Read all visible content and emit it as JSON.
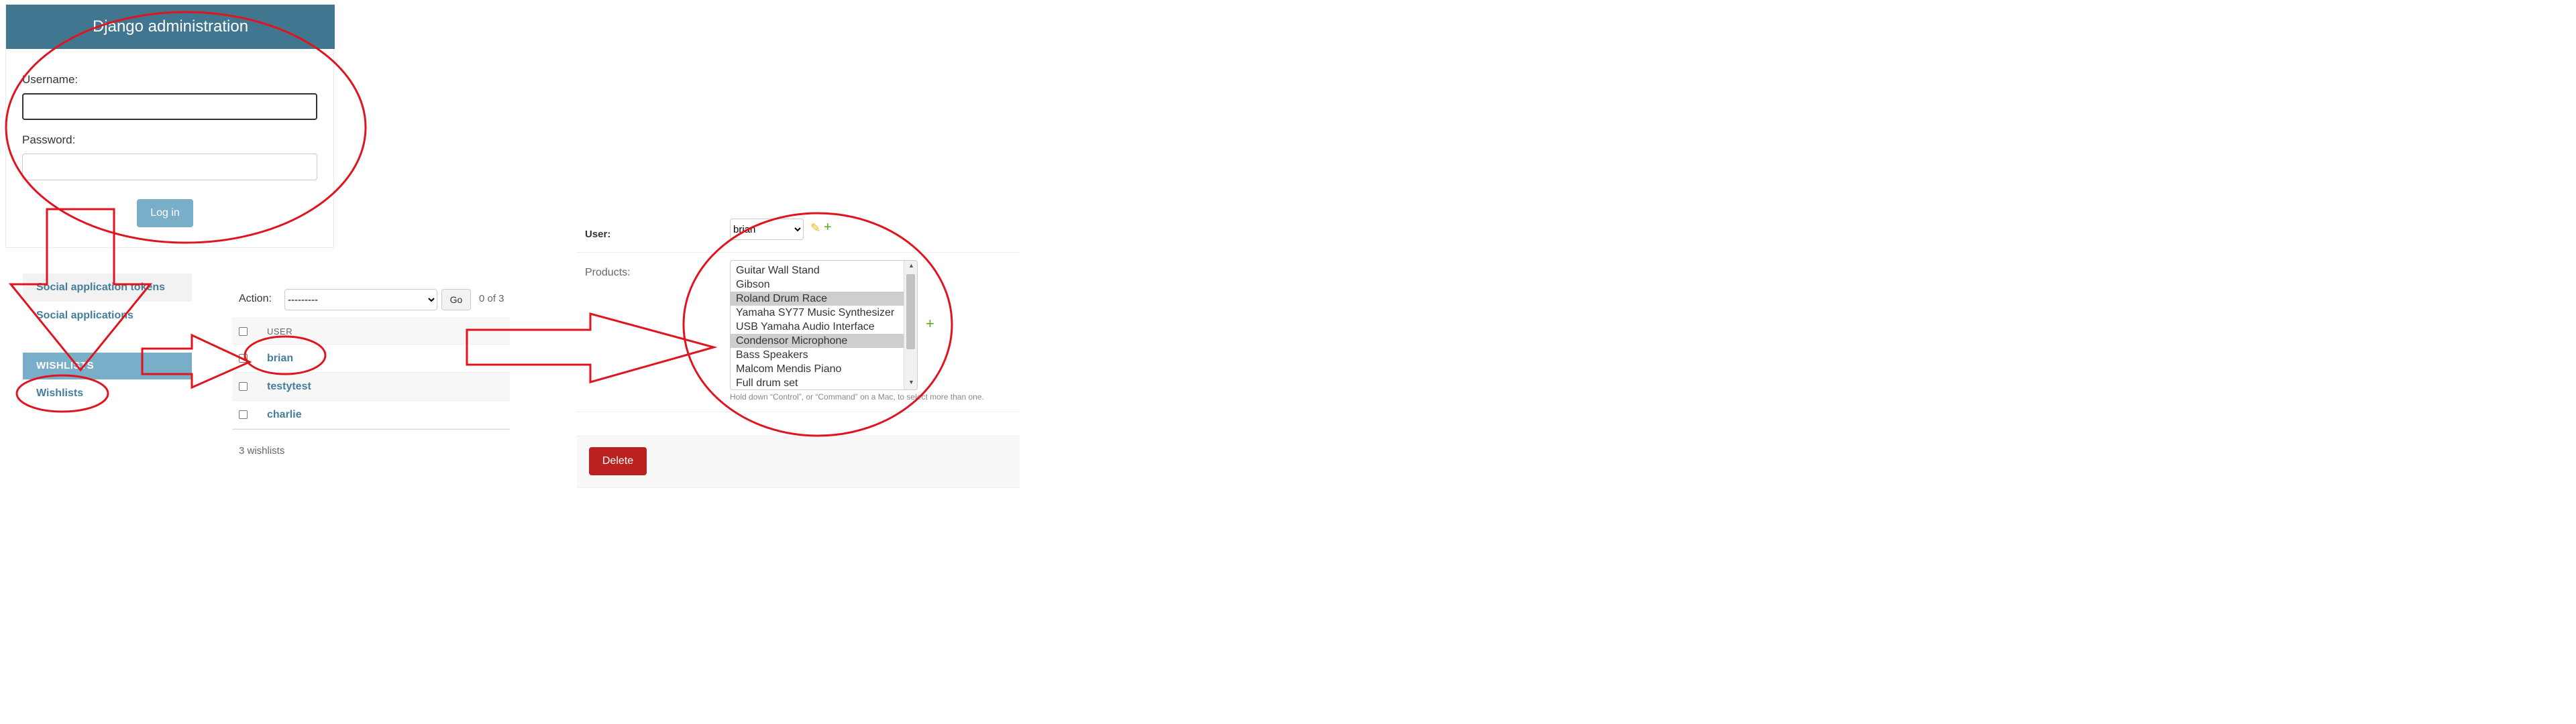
{
  "login": {
    "title": "Django administration",
    "username_label": "Username:",
    "username_value": "",
    "password_label": "Password:",
    "password_value": "",
    "button": "Log in"
  },
  "sidebar": {
    "items": [
      {
        "label": "Social application tokens"
      },
      {
        "label": "Social applications"
      }
    ],
    "section_caption": "WISHLISTS",
    "section_item": "Wishlists"
  },
  "changelist": {
    "action_label": "Action:",
    "action_value": "---------",
    "go_label": "Go",
    "selection_count": "0 of 3",
    "column_header": "USER",
    "rows": [
      {
        "user": "brian"
      },
      {
        "user": "testytest"
      },
      {
        "user": "charlie"
      }
    ],
    "footer": "3 wishlists"
  },
  "changeform": {
    "user_label": "User:",
    "user_value": "brian",
    "products_label": "Products:",
    "products": [
      {
        "name": "Guitar Wall Stand",
        "selected": false
      },
      {
        "name": "Gibson",
        "selected": false
      },
      {
        "name": "Roland Drum Race",
        "selected": true
      },
      {
        "name": "Yamaha SY77 Music Synthesizer",
        "selected": false
      },
      {
        "name": "USB Yamaha Audio Interface",
        "selected": false
      },
      {
        "name": "Condensor Microphone",
        "selected": true
      },
      {
        "name": "Bass Speakers",
        "selected": false
      },
      {
        "name": "Malcom Mendis Piano",
        "selected": false
      },
      {
        "name": "Full drum set",
        "selected": false
      }
    ],
    "help_text": "Hold down “Control”, or “Command” on a Mac, to select more than one.",
    "add_icon": "+",
    "delete_label": "Delete"
  },
  "colors": {
    "header": "#417690",
    "link": "#447e9b",
    "login_button": "#79aec8",
    "delete_button": "#ba2121",
    "annotation": "#e0141e"
  }
}
